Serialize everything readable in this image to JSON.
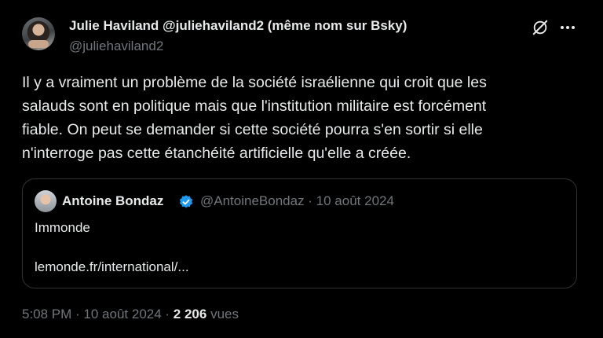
{
  "author": {
    "name_line": "Julie Haviland @juliehaviland2 (même nom sur Bsky)",
    "handle": "@juliehaviland2"
  },
  "tweet": {
    "lines": [
      "Il y a vraiment un problème de la société israélienne qui croit que les",
      "salauds sont en politique mais que l'institution militaire est forcément",
      "fiable. On peut se demander si cette société pourra s'en sortir si elle",
      "n'interroge pas cette étanchéité artificielle qu'elle a créée."
    ]
  },
  "quote": {
    "name": "Antoine Bondaz",
    "handle_date": "@AntoineBondaz · 10 août 2024",
    "text": "Immonde",
    "link": "lemonde.fr/international/..."
  },
  "meta": {
    "time_date": "5:08 PM · 10 août 2024 · ",
    "views_count": "2 206",
    "views_label": " vues"
  },
  "icons": {
    "grok": "grok-icon",
    "more": "more-icon",
    "verified": "verified-badge-icon"
  },
  "colors": {
    "background": "#000000",
    "text": "#e7e9ea",
    "muted": "#71767b",
    "border": "#2f3336",
    "verified": "#1d9bf0"
  }
}
